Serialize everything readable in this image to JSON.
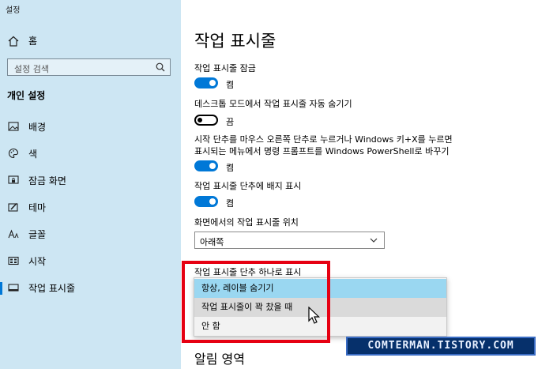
{
  "window": {
    "title": "설정"
  },
  "sidebar": {
    "home_label": "홈",
    "search_placeholder": "설정 검색",
    "section_title": "개인 설정",
    "items": [
      {
        "label": "배경",
        "icon": "image-icon"
      },
      {
        "label": "색",
        "icon": "palette-icon"
      },
      {
        "label": "잠금 화면",
        "icon": "lock-screen-icon"
      },
      {
        "label": "테마",
        "icon": "theme-brush-icon"
      },
      {
        "label": "글꼴",
        "icon": "font-icon"
      },
      {
        "label": "시작",
        "icon": "start-grid-icon"
      },
      {
        "label": "작업 표시줄",
        "icon": "taskbar-icon",
        "active": true
      }
    ]
  },
  "main": {
    "title": "작업 표시줄",
    "settings": [
      {
        "label": "작업 표시줄 잠금",
        "state": "켬",
        "on": true
      },
      {
        "label": "데스크톱 모드에서 작업 표시줄 자동 숨기기",
        "state": "끔",
        "on": false
      },
      {
        "label_line1": "시작 단추를 마우스 오른쪽 단추로 누르거나 Windows 키+X를 누르면",
        "label_line2": "표시되는 메뉴에서 명령 프롬프트를 Windows PowerShell로 바꾸기",
        "state": "켬",
        "on": true
      },
      {
        "label": "작업 표시줄 단추에 배지 표시",
        "state": "켬",
        "on": true
      }
    ],
    "position": {
      "label": "화면에서의 작업 표시줄 위치",
      "value": "아래쪽"
    },
    "combine": {
      "label": "작업 표시줄 단추 하나로 표시",
      "options": [
        "항상, 레이블 숨기기",
        "작업 표시줄이 꽉 찼을 때",
        "안 함"
      ],
      "selected_index": 0,
      "hover_index": 1
    },
    "next_section": "알림 영역"
  },
  "watermark": "COMTERMAN.TISTORY.COM",
  "colors": {
    "sidebar_bg": "#cde6f3",
    "accent": "#0078d7",
    "highlight_box": "#e60012",
    "selected_option": "#9ad7f1"
  }
}
